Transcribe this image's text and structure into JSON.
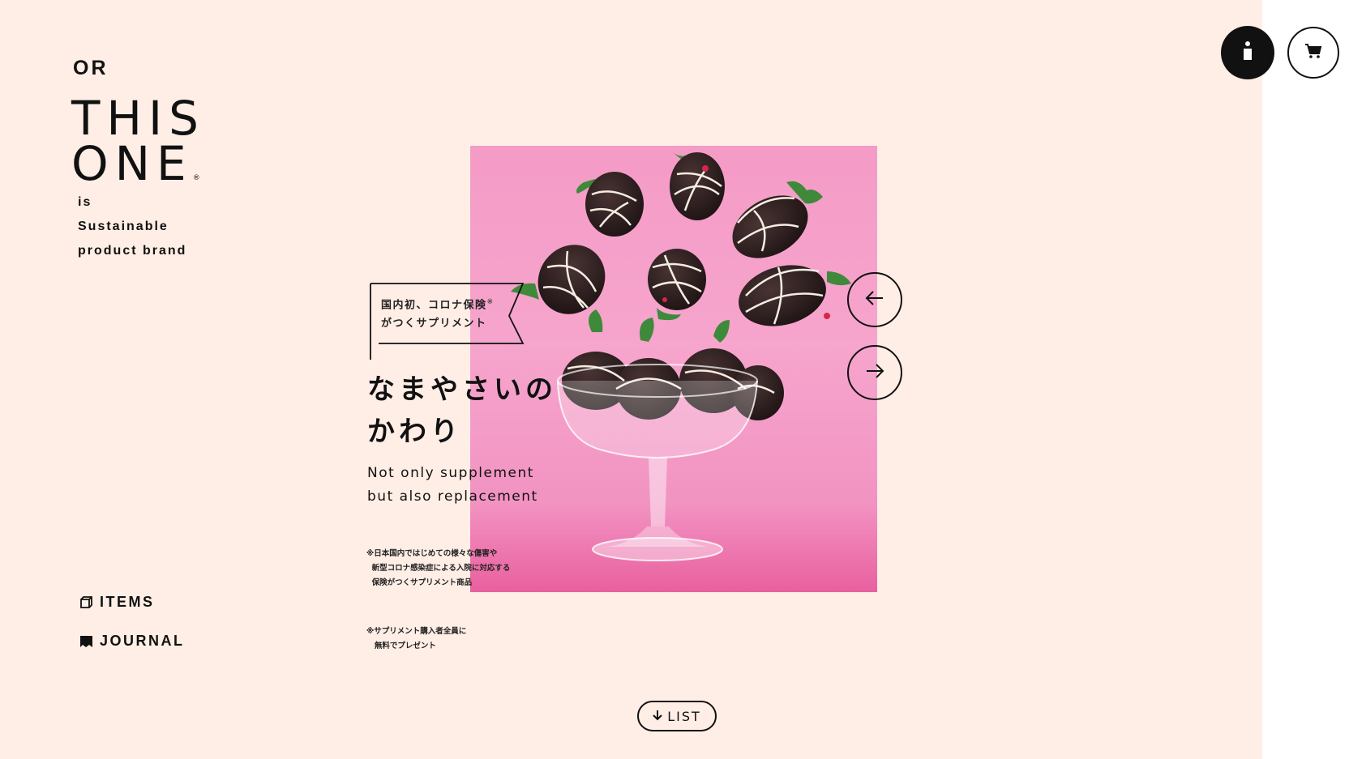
{
  "brand": {
    "prefix": "OR",
    "name_line1": "THIS",
    "name_line2": "ONE",
    "registered": "®",
    "tagline": [
      "is",
      "Sustainable",
      "product brand"
    ]
  },
  "nav": {
    "items_label": "ITEMS",
    "journal_label": "JOURNAL"
  },
  "header": {
    "account_icon": "person-icon",
    "cart_icon": "cart-icon"
  },
  "slide": {
    "badge_line1": "国内初、コロナ保険",
    "badge_mark": "※",
    "badge_line2": "がつくサプリメント",
    "headline_line1": "なまやさいの",
    "headline_line2": "かわり",
    "subtitle_line1": "Not only supplement",
    "subtitle_line2": "but also replacement",
    "note1": "※日本国内ではじめての様々な傷害や\n  新型コロナ感染症による入院に対応する\n  保険がつくサプリメント商品",
    "note2": "※サプリメント購入者全員に\n   無料でプレゼント",
    "image_alt": "chocolate-covered strawberries over a glass dessert cup on pink background"
  },
  "slider": {
    "prev_icon": "arrow-left-icon",
    "next_icon": "arrow-right-icon"
  },
  "list_button": {
    "label": "LIST",
    "icon": "arrow-down-icon"
  },
  "colors": {
    "background": "#ffeee6",
    "text": "#111111",
    "image_pink": "#f6a5cd"
  }
}
